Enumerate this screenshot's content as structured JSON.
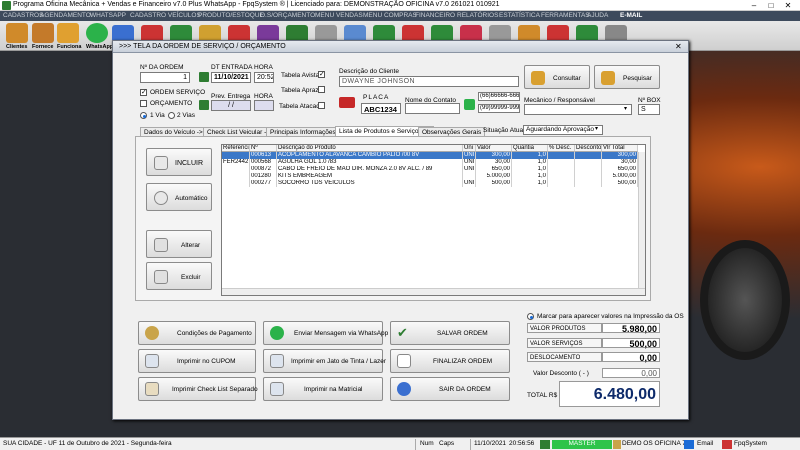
{
  "window": {
    "title": "Programa Oficina Mecânica + Vendas e Financeiro v7.0 Plus WhatsApp - FpqSystem ® | Licenciado para: DEMONSTRAÇÃO OFICINA v7.0 261021 010921",
    "minimize": "–",
    "maximize": "□",
    "close": "✕"
  },
  "menu": [
    "CADASTROS",
    "AGENDAMENTO",
    "WHATSAPP",
    "CADASTRO VEÍCULOS",
    "PRODUTO/ESTOQUE",
    "O.S/ORÇAMENTO",
    "MENU VENDAS",
    "MENU COMPRAS",
    "FINANCEIRO",
    "RELATÓRIOS",
    "ESTATÍSTICA",
    "FERRAMENTAS",
    "AJUDA",
    "E-MAIL"
  ],
  "toolbar": {
    "labels": [
      "Clientes",
      "Fornece",
      "Funciona",
      "WhatsApp"
    ],
    "icon_colors": [
      "#d08a2a",
      "#c47a2a",
      "#e0a030",
      "#2bb24a",
      "#3a6fd0",
      "#c33",
      "#2e8b3a",
      "#d0a030",
      "#c33",
      "#7a3a9a",
      "#2e7d32",
      "#999",
      "#5a8ad0",
      "#2e8b3a",
      "#c33",
      "#2e8b3a",
      "#c8304a",
      "#999",
      "#d08a2a",
      "#c33",
      "#2e8b3a",
      "#888"
    ]
  },
  "dialog": {
    "title": ">>> TELA DA ORDEM DE SERVIÇO / ORÇAMENTO",
    "close": "✕",
    "numero_label": "Nº DA ORDEM",
    "numero_value": "1",
    "dt_entrada_label": "DT ENTRADA",
    "dt_entrada_value": "11/10/2021",
    "hora_label": "HORA",
    "hora_value": "20:52",
    "prev_entrega_label": "Prev. Entrega",
    "prev_entrega_value": "/ /",
    "hora2_label": "HORA",
    "hora2_value": "",
    "ordem_servico_label": "ORDEM SERVIÇO",
    "orcamento_label": "ORÇAMENTO",
    "check_mark": "✓",
    "via1_label": "1 Via",
    "via2_label": "2 Vias",
    "tabela_avista_label": "Tabela Avista",
    "tabela_aprazo_label": "Tabela Aprazo",
    "tabela_atacado_label": "Tabela Atacado",
    "cliente_label": "Descrição do Cliente",
    "cliente_value": "DWAYNE JOHNSON",
    "consultar_label": "Consultar",
    "pesquisar_label": "Pesquisar",
    "placa_label": "PLACA",
    "placa_value": "ABC1234",
    "contato_label": "Nome do Contato",
    "contato_value": "",
    "telefone1": "(66)66666-6666",
    "telefone2": "(99)99999-9999",
    "mecanico_label": "Mecânico / Responsável",
    "mecanico_value": "",
    "nbox_label": "Nº BOX",
    "nbox_value": "S",
    "tabs": [
      "Dados do Veículo ->",
      "Check List Veicular ->",
      "Principais Informações ->",
      "Lista de Produtos e Serviços ->",
      "Observações Gerais"
    ],
    "situacao_label": "Situação Atual",
    "situacao_value": "Aguardando Aprovação",
    "side_buttons": {
      "incluir": "INCLUIR",
      "automatico": "Automático",
      "alterar": "Alterar",
      "excluir": "Excluir"
    },
    "grid": {
      "headers": [
        "Referencia",
        "Nº",
        "Descrição do Produto",
        "Uni",
        "Valor",
        "Quantia",
        "% Desc.",
        "Desconto",
        "Vlr Total"
      ],
      "rows": [
        [
          "",
          "000613",
          "ACOPLAMENTO ALAVANCA CAMBIO PALIO /00 8V",
          "UNI",
          "300,00",
          "1,0",
          "",
          "",
          "300,00"
        ],
        [
          "FER2442",
          "000568",
          "AGULHA GOL 1.0 /83",
          "UNI",
          "30,00",
          "1,0",
          "",
          "",
          "30,00"
        ],
        [
          "",
          "000872",
          "CABO DE FREIO DE MAO DIR. MONZA 2.0 8V ALC. / 89",
          "UNI",
          "650,00",
          "1,0",
          "",
          "",
          "650,00"
        ],
        [
          "",
          "001280",
          "KITS EMBREAGEM",
          "",
          "5.000,00",
          "1,0",
          "",
          "",
          "5.000,00"
        ],
        [
          "",
          "000277",
          "SOCORRO TDS VEICULOS",
          "UNI",
          "500,00",
          "1,0",
          "",
          "",
          "500,00"
        ]
      ],
      "selected_row": 0
    },
    "bottom_buttons": {
      "condicoes": "Condições de Pagamento",
      "whatsapp": "Enviar Mensagem via WhatsApp",
      "salvar": "SALVAR ORDEM",
      "cupom": "Imprimir no CUPOM",
      "jato": "Imprimir em Jato de Tinta / Lazer",
      "finalizar": "FINALIZAR ORDEM",
      "checklist": "Imprimir Check List Separado",
      "matricial": "Imprimir na Matricial",
      "sair": "SAIR DA ORDEM"
    },
    "summary": {
      "marcar_label": "Marcar para aparecer valores na Impressão da OS",
      "valor_produtos_label": "VALOR PRODUTOS",
      "valor_produtos": "5.980,00",
      "valor_servicos_label": "VALOR SERVIÇOS",
      "valor_servicos": "500,00",
      "deslocamento_label": "DESLOCAMENTO",
      "deslocamento": "0,00",
      "desconto_label": "Valor Desconto ( - )",
      "desconto": "0,00",
      "total_label": "TOTAL R$",
      "total": "6.480,00"
    }
  },
  "statusbar": {
    "left": "SUA CIDADE - UF 11 de Outubro de 2021 - Segunda-feira",
    "num": "Num",
    "caps": "Caps",
    "date": "11/10/2021",
    "time": "20:56:56",
    "master": "MASTER",
    "demo": "DEMO OS OFICINA 7.0",
    "email": "Email",
    "brand": "FpqSystem"
  }
}
